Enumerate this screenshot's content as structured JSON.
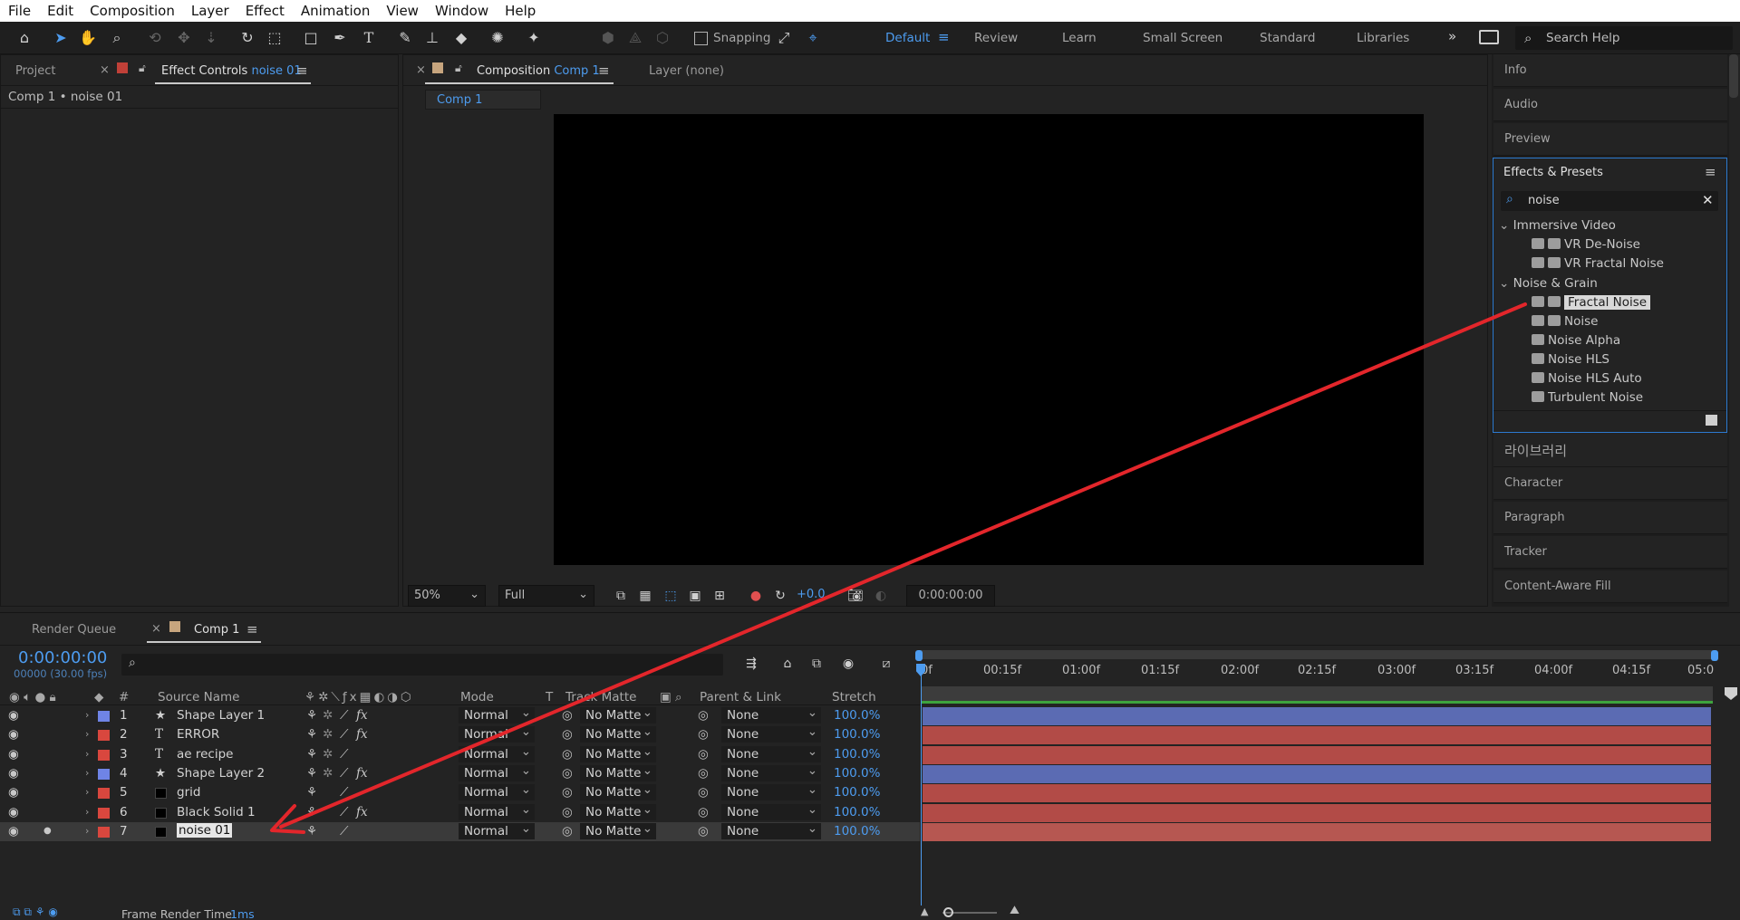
{
  "menu": [
    "File",
    "Edit",
    "Composition",
    "Layer",
    "Effect",
    "Animation",
    "View",
    "Window",
    "Help"
  ],
  "toolbar": {
    "snapping_label": "Snapping",
    "workspaces": [
      "Default",
      "Review",
      "Learn",
      "Small Screen",
      "Standard",
      "Libraries"
    ],
    "active_workspace": "Default",
    "search_placeholder": "Search Help"
  },
  "left_panel": {
    "tab_project": "Project",
    "tab_effect_controls": "Effect Controls",
    "tab_effect_controls_layer": "noise 01",
    "breadcrumb": "Comp 1 • noise 01"
  },
  "comp_panel": {
    "tab_label": "Composition",
    "tab_comp": "Comp 1",
    "layer_tab": "Layer (none)",
    "flow_tab": "Comp 1",
    "zoom": "50%",
    "resolution": "Full",
    "exposure": "+0.0",
    "timecode": "0:00:00:00"
  },
  "right_panels": {
    "info": "Info",
    "audio": "Audio",
    "preview": "Preview",
    "effects_title": "Effects & Presets",
    "search_value": "noise",
    "libraries": "라이브러리",
    "character": "Character",
    "paragraph": "Paragraph",
    "tracker": "Tracker",
    "content_aware": "Content-Aware Fill"
  },
  "effects_tree": {
    "group1": "Immersive Video",
    "group1_items": [
      "VR De-Noise",
      "VR Fractal Noise"
    ],
    "group2": "Noise & Grain",
    "group2_items": [
      "Fractal Noise",
      "Noise",
      "Noise Alpha",
      "Noise HLS",
      "Noise HLS Auto",
      "Turbulent Noise"
    ],
    "selected": "Fractal Noise"
  },
  "timeline": {
    "tab_render_queue": "Render Queue",
    "tab_comp": "Comp 1",
    "current_time": "0:00:00:00",
    "frame_info": "00000 (30.00 fps)",
    "columns": {
      "num": "#",
      "source": "Source Name",
      "mode": "Mode",
      "t": "T",
      "track_matte": "Track Matte",
      "parent": "Parent & Link",
      "stretch": "Stretch"
    },
    "ruler": [
      "0f",
      "00:15f",
      "01:00f",
      "01:15f",
      "02:00f",
      "02:15f",
      "03:00f",
      "03:15f",
      "04:00f",
      "04:15f",
      "05:0"
    ],
    "layers": [
      {
        "num": "1",
        "name": "Shape Layer 1",
        "type_icon": "star",
        "label_color": "#6f84e6",
        "mode": "Normal",
        "matte": "No Matte",
        "parent": "None",
        "stretch": "100.0%"
      },
      {
        "num": "2",
        "name": "ERROR",
        "type_icon": "text",
        "label_color": "#d9473e",
        "mode": "Normal",
        "matte": "No Matte",
        "parent": "None",
        "stretch": "100.0%"
      },
      {
        "num": "3",
        "name": "ae recipe",
        "type_icon": "text",
        "label_color": "#d9473e",
        "mode": "Normal",
        "matte": "No Matte",
        "parent": "None",
        "stretch": "100.0%"
      },
      {
        "num": "4",
        "name": "Shape Layer 2",
        "type_icon": "star",
        "label_color": "#6f84e6",
        "mode": "Normal",
        "matte": "No Matte",
        "parent": "None",
        "stretch": "100.0%"
      },
      {
        "num": "5",
        "name": "grid",
        "type_icon": "solid",
        "label_color": "#d9473e",
        "mode": "Normal",
        "matte": "No Matte",
        "parent": "None",
        "stretch": "100.0%"
      },
      {
        "num": "6",
        "name": "Black Solid 1",
        "type_icon": "solid",
        "label_color": "#d9473e",
        "mode": "Normal",
        "matte": "No Matte",
        "parent": "None",
        "stretch": "100.0%"
      },
      {
        "num": "7",
        "name": "noise 01",
        "type_icon": "solid",
        "label_color": "#d9473e",
        "mode": "Normal",
        "matte": "No Matte",
        "parent": "None",
        "stretch": "100.0%"
      }
    ],
    "frame_render_label": "Frame Render Time:",
    "frame_render_value": "1ms"
  },
  "colors": {
    "accent": "#4d9cf0",
    "annotation_arrow": "#e3262b",
    "blue_bar": "#5b6bb3",
    "red_bar": "#b24b47"
  }
}
